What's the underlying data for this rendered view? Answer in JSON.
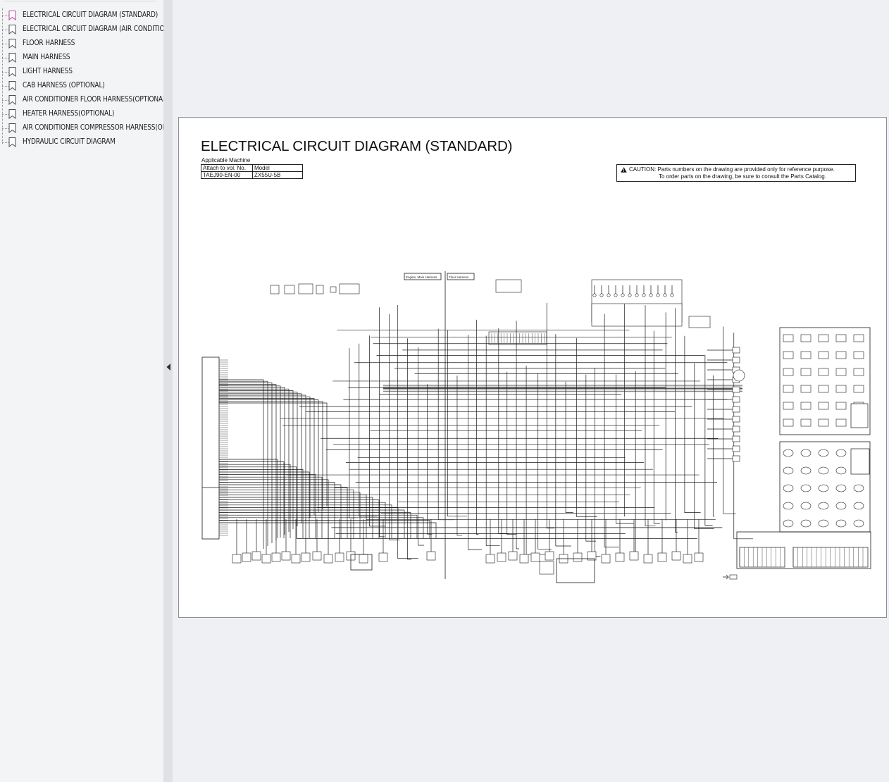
{
  "bookmarks": {
    "items": [
      {
        "label": "ELECTRICAL CIRCUIT DIAGRAM (STANDARD)",
        "active": true
      },
      {
        "label": "ELECTRICAL CIRCUIT DIAGRAM (AIR CONDITIONER",
        "active": false
      },
      {
        "label": "FLOOR HARNESS",
        "active": false
      },
      {
        "label": "MAIN HARNESS",
        "active": false
      },
      {
        "label": "LIGHT HARNESS",
        "active": false
      },
      {
        "label": "CAB HARNESS (OPTIONAL)",
        "active": false
      },
      {
        "label": "AIR CONDITIONER FLOOR HARNESS(OPTIONAL)",
        "active": false
      },
      {
        "label": "HEATER HARNESS(OPTIONAL)",
        "active": false
      },
      {
        "label": "AIR CONDITIONER COMPRESSOR HARNESS(OPTIC",
        "active": false
      },
      {
        "label": "HYDRAULIC CIRCUIT DIAGRAM",
        "active": false
      }
    ],
    "icon": "bookmark-icon",
    "active_color": "#c0389a",
    "inactive_color": "#4a4d52"
  },
  "splitter": {
    "icon": "chevron-left-icon"
  },
  "document": {
    "title": "ELECTRICAL CIRCUIT DIAGRAM (STANDARD)",
    "applicable_label": "Applicable Machine",
    "table": {
      "headers": [
        "Attach to vol. No.",
        "Model"
      ],
      "row": [
        "TAEJ90-EN-00",
        "ZX55U-5B"
      ]
    },
    "caution": {
      "icon": "warning-icon",
      "line1": "CAUTION: Parts numbers on the drawing are provided only for reference purpose.",
      "line2": "To order parts on the drawing, be sure to consult the Parts Catalog."
    },
    "harness_tags": [
      "Engine, Main Harness",
      "Floor Harness"
    ]
  }
}
